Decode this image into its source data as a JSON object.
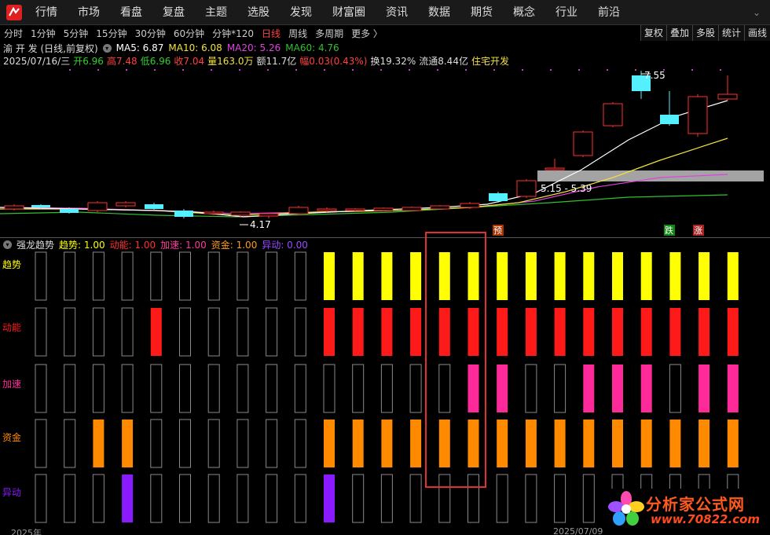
{
  "nav": {
    "items": [
      "行情",
      "市场",
      "看盘",
      "复盘",
      "主题",
      "选股",
      "发现",
      "财富圈",
      "资讯",
      "数据",
      "期货",
      "概念",
      "行业",
      "前沿"
    ],
    "chevron": "⌄"
  },
  "toolbar": {
    "periods": [
      "分时",
      "1分钟",
      "5分钟",
      "15分钟",
      "30分钟",
      "60分钟",
      "分钟*120",
      "日线",
      "周线",
      "多周期",
      "更多 〉"
    ],
    "active": "日线",
    "right_buttons": [
      "复权",
      "叠加",
      "多股",
      "统计",
      "画线"
    ]
  },
  "info": {
    "stock": "渝 开 发 (日线,前复权)",
    "ma5": "MA5: 6.87",
    "ma10": "MA10: 6.08",
    "ma20": "MA20: 5.26",
    "ma60": "MA60: 4.76",
    "date": "2025/07/16/三",
    "open": "开6.96",
    "high": "高7.48",
    "low": "低6.96",
    "close": "收7.04",
    "volume": "量163.0万",
    "amount": "额11.7亿",
    "amp": "幅0.03(0.43%)",
    "turnover": "换19.32%",
    "float": "流通8.44亿",
    "sector": "住宅开发"
  },
  "colors": {
    "up": "#ff3030",
    "down": "#54f0ff",
    "ma5": "#ffffff",
    "ma10": "#f0e040",
    "ma20": "#e040e0",
    "ma60": "#30c030",
    "trend": "#ffff00",
    "momentum": "#ff1a1a",
    "accel": "#ff2a9a",
    "capital": "#ff8a00",
    "anomaly": "#8a1aff",
    "highlight": "#e03030"
  },
  "chart_labels": {
    "high_mark": "7.55",
    "low_mark": "4.17",
    "zone": "5.15 - 5.39",
    "tag_pre": "预",
    "tag_die": "跌",
    "tag_zhang": "涨"
  },
  "indicator": {
    "name": "强龙趋势",
    "vals": {
      "trend": "趋势: 1.00",
      "momentum": "动能: 1.00",
      "accel": "加速: 1.00",
      "capital": "资金: 1.00",
      "anomaly": "异动: 0.00"
    },
    "row_labels": [
      "趋势",
      "动能",
      "加速",
      "资金",
      "异动"
    ],
    "rows": {
      "trend": [
        0,
        0,
        0,
        0,
        0,
        0,
        0,
        0,
        0,
        0,
        1,
        1,
        1,
        1,
        1,
        1,
        1,
        1,
        1,
        1,
        1,
        1,
        1,
        1,
        1
      ],
      "momentum": [
        0,
        0,
        0,
        0,
        1,
        0,
        0,
        0,
        0,
        0,
        1,
        1,
        1,
        1,
        1,
        1,
        1,
        1,
        1,
        1,
        1,
        1,
        1,
        1,
        1
      ],
      "accel": [
        0,
        0,
        0,
        0,
        0,
        0,
        0,
        0,
        0,
        0,
        0,
        0,
        0,
        0,
        0,
        1,
        1,
        0,
        0,
        1,
        1,
        1,
        0,
        1,
        1
      ],
      "capital": [
        0,
        0,
        1,
        1,
        0,
        0,
        0,
        0,
        0,
        0,
        1,
        1,
        1,
        1,
        1,
        1,
        1,
        1,
        1,
        1,
        1,
        1,
        1,
        1,
        1
      ],
      "anomaly": [
        0,
        0,
        0,
        1,
        0,
        0,
        0,
        0,
        0,
        0,
        1,
        0,
        0,
        0,
        0,
        0,
        0,
        0,
        0,
        0,
        0,
        0,
        0,
        0,
        0
      ]
    }
  },
  "watermark": {
    "title": "分析家公式网",
    "url": "www.70822.com"
  },
  "footer": {
    "left": "2025年",
    "right": "2025/07/09"
  }
}
